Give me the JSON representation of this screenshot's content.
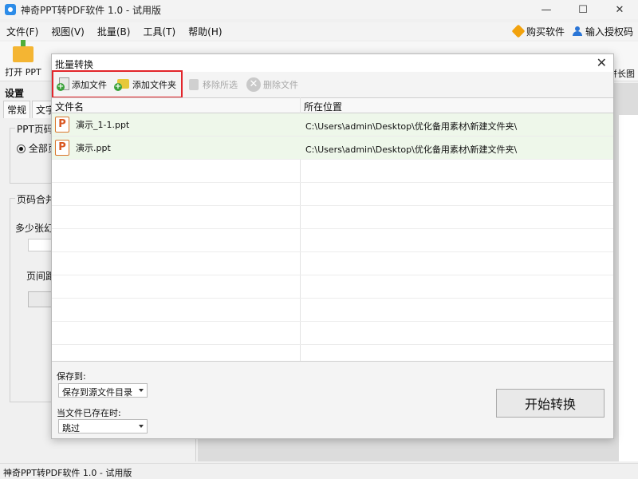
{
  "window": {
    "title": "神奇PPT转PDF软件 1.0 - 试用版",
    "minimize": "—",
    "maximize": "☐",
    "close": "✕"
  },
  "menu": {
    "items": [
      "文件(F)",
      "视图(V)",
      "批量(B)",
      "工具(T)",
      "帮助(H)"
    ],
    "buy": "购买软件",
    "license": "输入授权码"
  },
  "toolbar": {
    "open": "打开 PPT",
    "right_fragment": "拼长图"
  },
  "settings": {
    "title": "设置",
    "tab1": "常规",
    "tab2": "文字",
    "group1": "PPT页码",
    "radio1": "全部页",
    "group2": "页码合并",
    "label_slides": "多少张幻",
    "label_gap": "页间距"
  },
  "statusbar": {
    "text": "神奇PPT转PDF软件 1.0 - 试用版"
  },
  "dialog": {
    "title": "批量转换",
    "close": "✕",
    "toolbar": {
      "add_file": "添加文件",
      "add_folder": "添加文件夹",
      "remove_selected": "移除所选",
      "delete_file": "删除文件"
    },
    "table": {
      "col_name": "文件名",
      "col_location": "所在位置",
      "rows": [
        {
          "name": "演示_1-1.ppt",
          "path": "C:\\Users\\admin\\Desktop\\优化备用素材\\新建文件夹\\"
        },
        {
          "name": "演示.ppt",
          "path": "C:\\Users\\admin\\Desktop\\优化备用素材\\新建文件夹\\"
        }
      ]
    },
    "save_to_label": "保存到:",
    "save_to_value": "保存到源文件目录",
    "exists_label": "当文件已存在时:",
    "exists_value": "跳过",
    "start_button": "开始转换"
  },
  "colors": {
    "highlight": "#e2252b",
    "row_fill": "#eef7ea"
  }
}
